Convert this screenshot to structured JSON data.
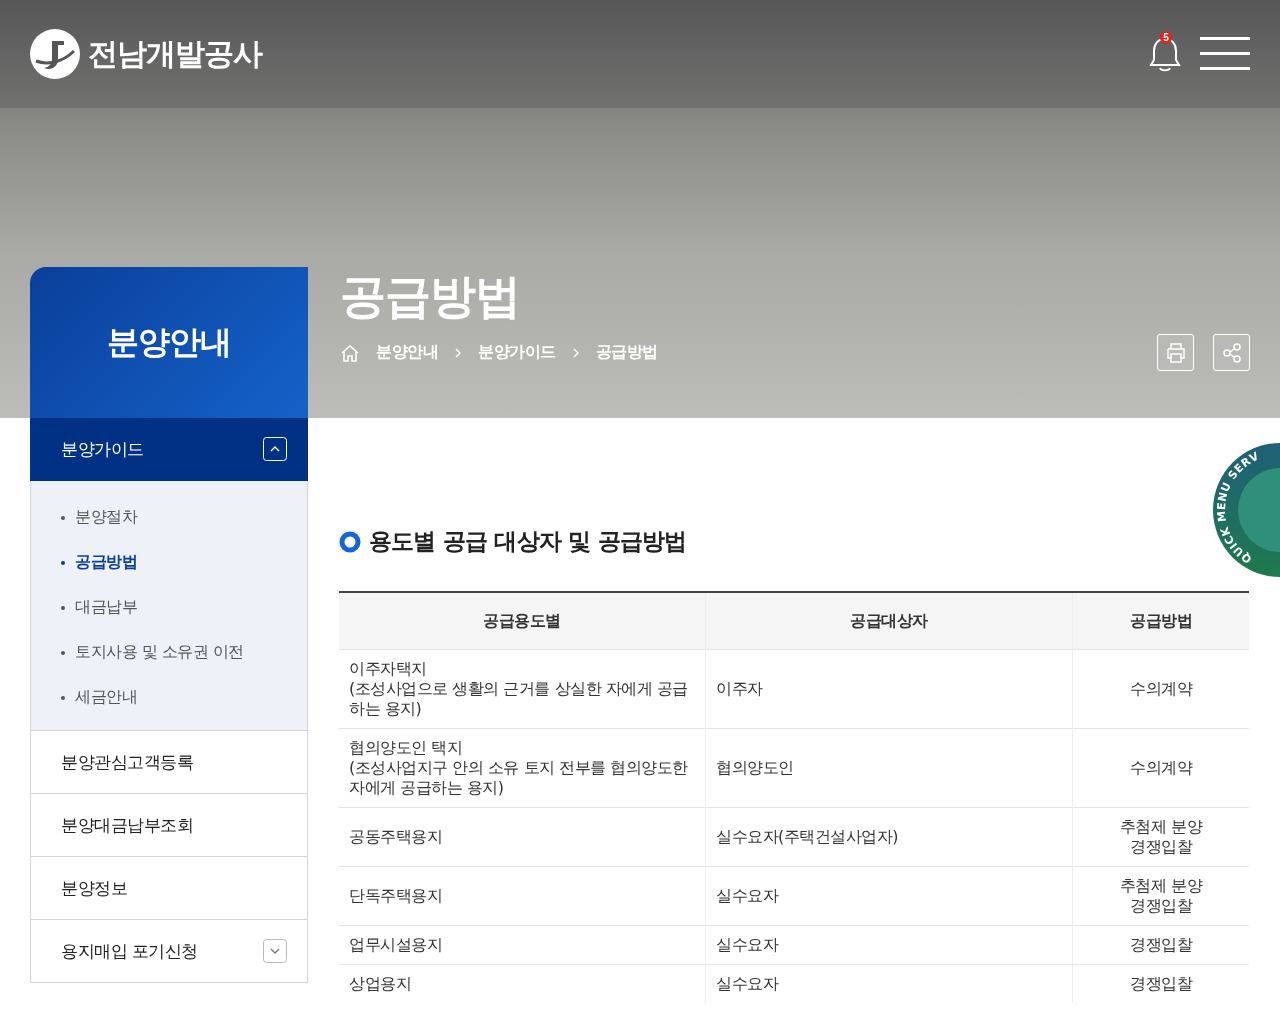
{
  "header": {
    "logo_text": "전남개발공사",
    "notification_count": "5"
  },
  "page_title": "공급방법",
  "breadcrumb": [
    "분양안내",
    "분양가이드",
    "공급방법"
  ],
  "sidebar": {
    "title": "분양안내",
    "items": [
      {
        "label": "분양가이드",
        "kind": "group",
        "expanded": true,
        "children": [
          {
            "label": "분양절차",
            "selected": false
          },
          {
            "label": "공급방법",
            "selected": true
          },
          {
            "label": "대금납부",
            "selected": false
          },
          {
            "label": "토지사용 및 소유권 이전",
            "selected": false
          },
          {
            "label": "세금안내",
            "selected": false
          }
        ]
      },
      {
        "label": "분양관심고객등록",
        "kind": "link"
      },
      {
        "label": "분양대금납부조회",
        "kind": "link"
      },
      {
        "label": "분양정보",
        "kind": "link"
      },
      {
        "label": "용지매입 포기신청",
        "kind": "group",
        "expanded": false
      }
    ]
  },
  "quick_menu": {
    "label": "QUICK MENU SERV"
  },
  "section": {
    "title": "용도별 공급 대상자 및 공급방법"
  },
  "table": {
    "columns": [
      "공급용도별",
      "공급대상자",
      "공급방법"
    ],
    "rows": [
      [
        "이주자택지\n(조성사업으로 생활의 근거를 상실한 자에게 공급하는 용지)",
        "이주자",
        "수의계약"
      ],
      [
        "협의양도인 택지\n(조성사업지구 안의 소유 토지 전부를 협의양도한 자에게 공급하는 용지)",
        "협의양도인",
        "수의계약"
      ],
      [
        "공동주택용지",
        "실수요자(주택건설사업자)",
        "추첨제 분양\n경쟁입찰"
      ],
      [
        "단독주택용지",
        "실수요자",
        "추첨제 분양\n경쟁입찰"
      ],
      [
        "업무시설용지",
        "실수요자",
        "경쟁입찰"
      ],
      [
        "상업용지",
        "실수요자",
        "경쟁입찰"
      ]
    ]
  }
}
